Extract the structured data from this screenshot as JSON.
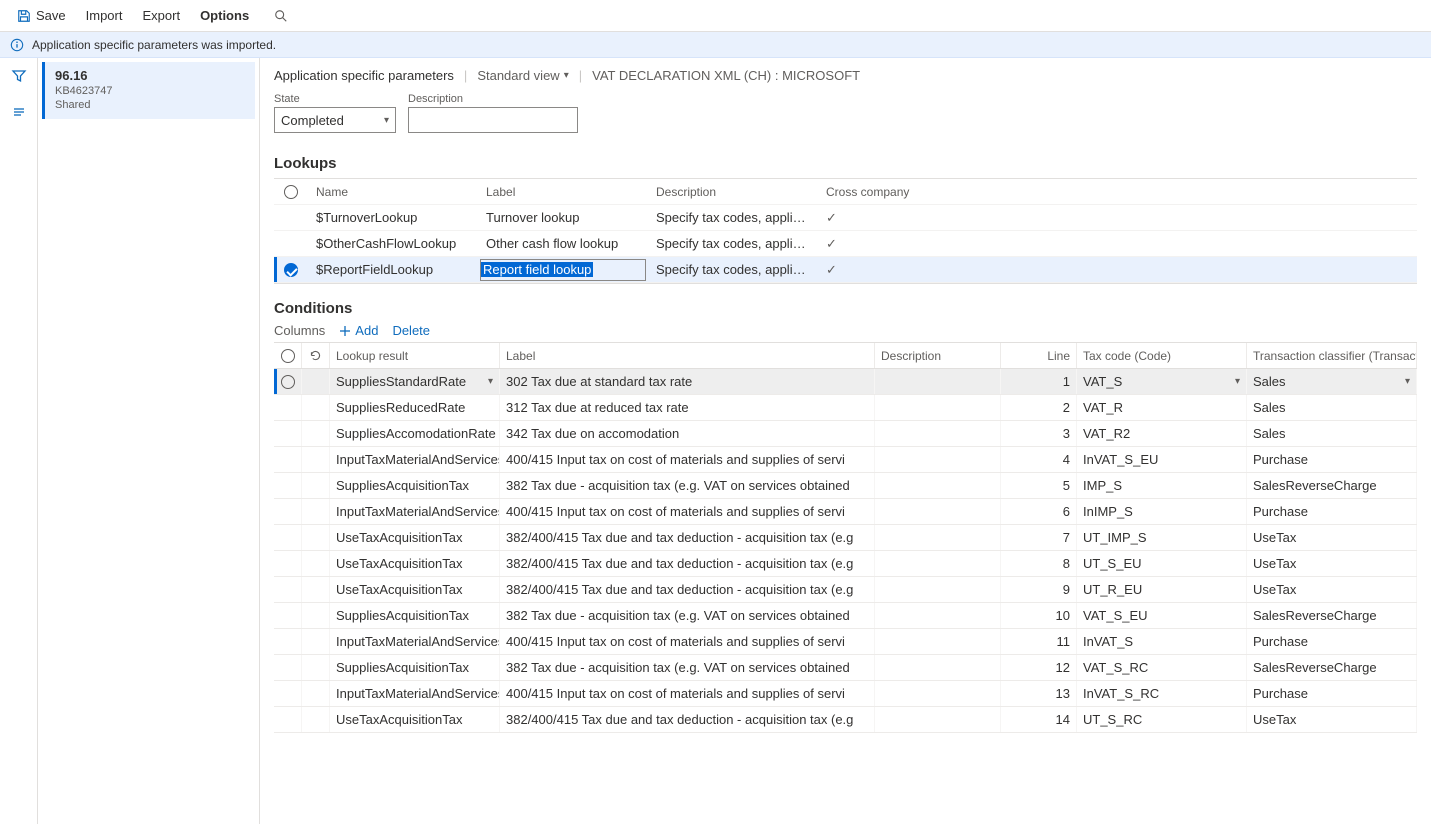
{
  "toolbar": {
    "save": "Save",
    "import": "Import",
    "export": "Export",
    "options": "Options"
  },
  "infobar": {
    "message": "Application specific parameters was imported."
  },
  "sidebar_card": {
    "version": "96.16",
    "kb": "KB4623747",
    "shared": "Shared"
  },
  "crumbs": {
    "title": "Application specific parameters",
    "view": "Standard view",
    "decl": "VAT DECLARATION XML (CH) : MICROSOFT"
  },
  "fields": {
    "state_label": "State",
    "state_value": "Completed",
    "description_label": "Description",
    "description_value": ""
  },
  "lookups": {
    "title": "Lookups",
    "cols": {
      "name": "Name",
      "label": "Label",
      "description": "Description",
      "cross": "Cross company"
    },
    "rows": [
      {
        "name": "$TurnoverLookup",
        "label": "Turnover lookup",
        "desc": "Specify tax codes, applicable for...",
        "cross": true,
        "selected": false
      },
      {
        "name": "$OtherCashFlowLookup",
        "label": "Other cash flow lookup",
        "desc": "Specify tax codes, applicable for...",
        "cross": true,
        "selected": false
      },
      {
        "name": "$ReportFieldLookup",
        "label": "Report field lookup",
        "desc": "Specify tax codes, applicable for...",
        "cross": true,
        "selected": true
      }
    ]
  },
  "conditions": {
    "title": "Conditions",
    "tools": {
      "columns": "Columns",
      "add": "Add",
      "delete": "Delete"
    },
    "cols": {
      "result": "Lookup result",
      "label": "Label",
      "desc": "Description",
      "line": "Line",
      "code": "Tax code (Code)",
      "tran": "Transaction classifier (TransactionCla..."
    },
    "rows": [
      {
        "result": "SuppliesStandardRate",
        "label": "302 Tax due at standard tax rate",
        "desc": "",
        "line": 1,
        "code": "VAT_S",
        "tran": "Sales",
        "selected": true
      },
      {
        "result": "SuppliesReducedRate",
        "label": "312 Tax due at reduced tax rate",
        "desc": "",
        "line": 2,
        "code": "VAT_R",
        "tran": "Sales"
      },
      {
        "result": "SuppliesAccomodationRate",
        "label": "342 Tax due on accomodation",
        "desc": "",
        "line": 3,
        "code": "VAT_R2",
        "tran": "Sales"
      },
      {
        "result": "InputTaxMaterialAndServices",
        "label": "400/415 Input tax on cost of materials and supplies of servi",
        "desc": "",
        "line": 4,
        "code": "InVAT_S_EU",
        "tran": "Purchase"
      },
      {
        "result": "SuppliesAcquisitionTax",
        "label": "382 Tax due - acquisition tax (e.g. VAT on services obtained",
        "desc": "",
        "line": 5,
        "code": "IMP_S",
        "tran": "SalesReverseCharge"
      },
      {
        "result": "InputTaxMaterialAndServices",
        "label": "400/415 Input tax on cost of materials and supplies of servi",
        "desc": "",
        "line": 6,
        "code": "InIMP_S",
        "tran": "Purchase"
      },
      {
        "result": "UseTaxAcquisitionTax",
        "label": "382/400/415 Tax due and tax deduction - acquisition tax (e.g",
        "desc": "",
        "line": 7,
        "code": "UT_IMP_S",
        "tran": "UseTax"
      },
      {
        "result": "UseTaxAcquisitionTax",
        "label": "382/400/415 Tax due and tax deduction - acquisition tax (e.g",
        "desc": "",
        "line": 8,
        "code": "UT_S_EU",
        "tran": "UseTax"
      },
      {
        "result": "UseTaxAcquisitionTax",
        "label": "382/400/415 Tax due and tax deduction - acquisition tax (e.g",
        "desc": "",
        "line": 9,
        "code": "UT_R_EU",
        "tran": "UseTax"
      },
      {
        "result": "SuppliesAcquisitionTax",
        "label": "382 Tax due - acquisition tax (e.g. VAT on services obtained",
        "desc": "",
        "line": 10,
        "code": "VAT_S_EU",
        "tran": "SalesReverseCharge"
      },
      {
        "result": "InputTaxMaterialAndServices",
        "label": "400/415 Input tax on cost of materials and supplies of servi",
        "desc": "",
        "line": 11,
        "code": "InVAT_S",
        "tran": "Purchase"
      },
      {
        "result": "SuppliesAcquisitionTax",
        "label": "382 Tax due - acquisition tax (e.g. VAT on services obtained",
        "desc": "",
        "line": 12,
        "code": "VAT_S_RC",
        "tran": "SalesReverseCharge"
      },
      {
        "result": "InputTaxMaterialAndServices",
        "label": "400/415 Input tax on cost of materials and supplies of servi",
        "desc": "",
        "line": 13,
        "code": "InVAT_S_RC",
        "tran": "Purchase"
      },
      {
        "result": "UseTaxAcquisitionTax",
        "label": "382/400/415 Tax due and tax deduction - acquisition tax (e.g",
        "desc": "",
        "line": 14,
        "code": "UT_S_RC",
        "tran": "UseTax"
      }
    ]
  }
}
